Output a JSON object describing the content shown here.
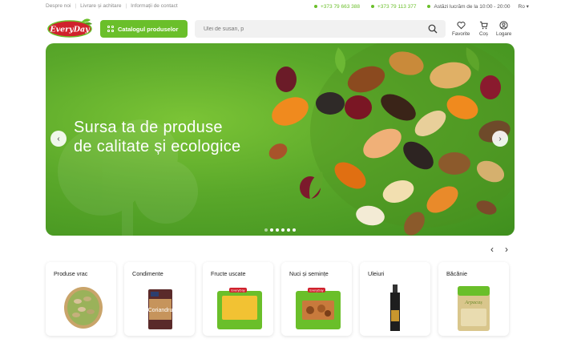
{
  "topbar": {
    "links": [
      "Despre noi",
      "Livrare și achitare",
      "Informații de contact"
    ],
    "phone1": "+373 79 663 388",
    "phone2": "+373 79 113 377",
    "hours": "Astăzi lucrăm de la 10:00 - 20:00",
    "lang": "Ro"
  },
  "header": {
    "logo_text": "EveryDay",
    "catalog_label": "Catalogul produselor",
    "search_placeholder": "Ulei de susan, p",
    "favorites_label": "Favorite",
    "cart_label": "Coș",
    "login_label": "Logare"
  },
  "hero": {
    "title_line1": "Sursa ta de produse",
    "title_line2": "de calitate și ecologice",
    "slides": 6,
    "active_slide": 2
  },
  "categories": [
    {
      "label": "Produse vrac",
      "icon": "pistachio-bowl"
    },
    {
      "label": "Condimente",
      "icon": "coriander-pack"
    },
    {
      "label": "Fructe uscate",
      "icon": "dried-fruit-pack"
    },
    {
      "label": "Nuci și semințe",
      "icon": "nuts-pack"
    },
    {
      "label": "Uleiuri",
      "icon": "oil-bottle"
    },
    {
      "label": "Băcănie",
      "icon": "flour-pack"
    }
  ],
  "pack_texts": {
    "coriander": "Coriandru",
    "everyday_small": "EveryDay",
    "flour": "Arpacaș"
  },
  "colors": {
    "accent": "#6abf2a",
    "hero_green": "#5aa82a",
    "logo_red": "#d0222d"
  }
}
